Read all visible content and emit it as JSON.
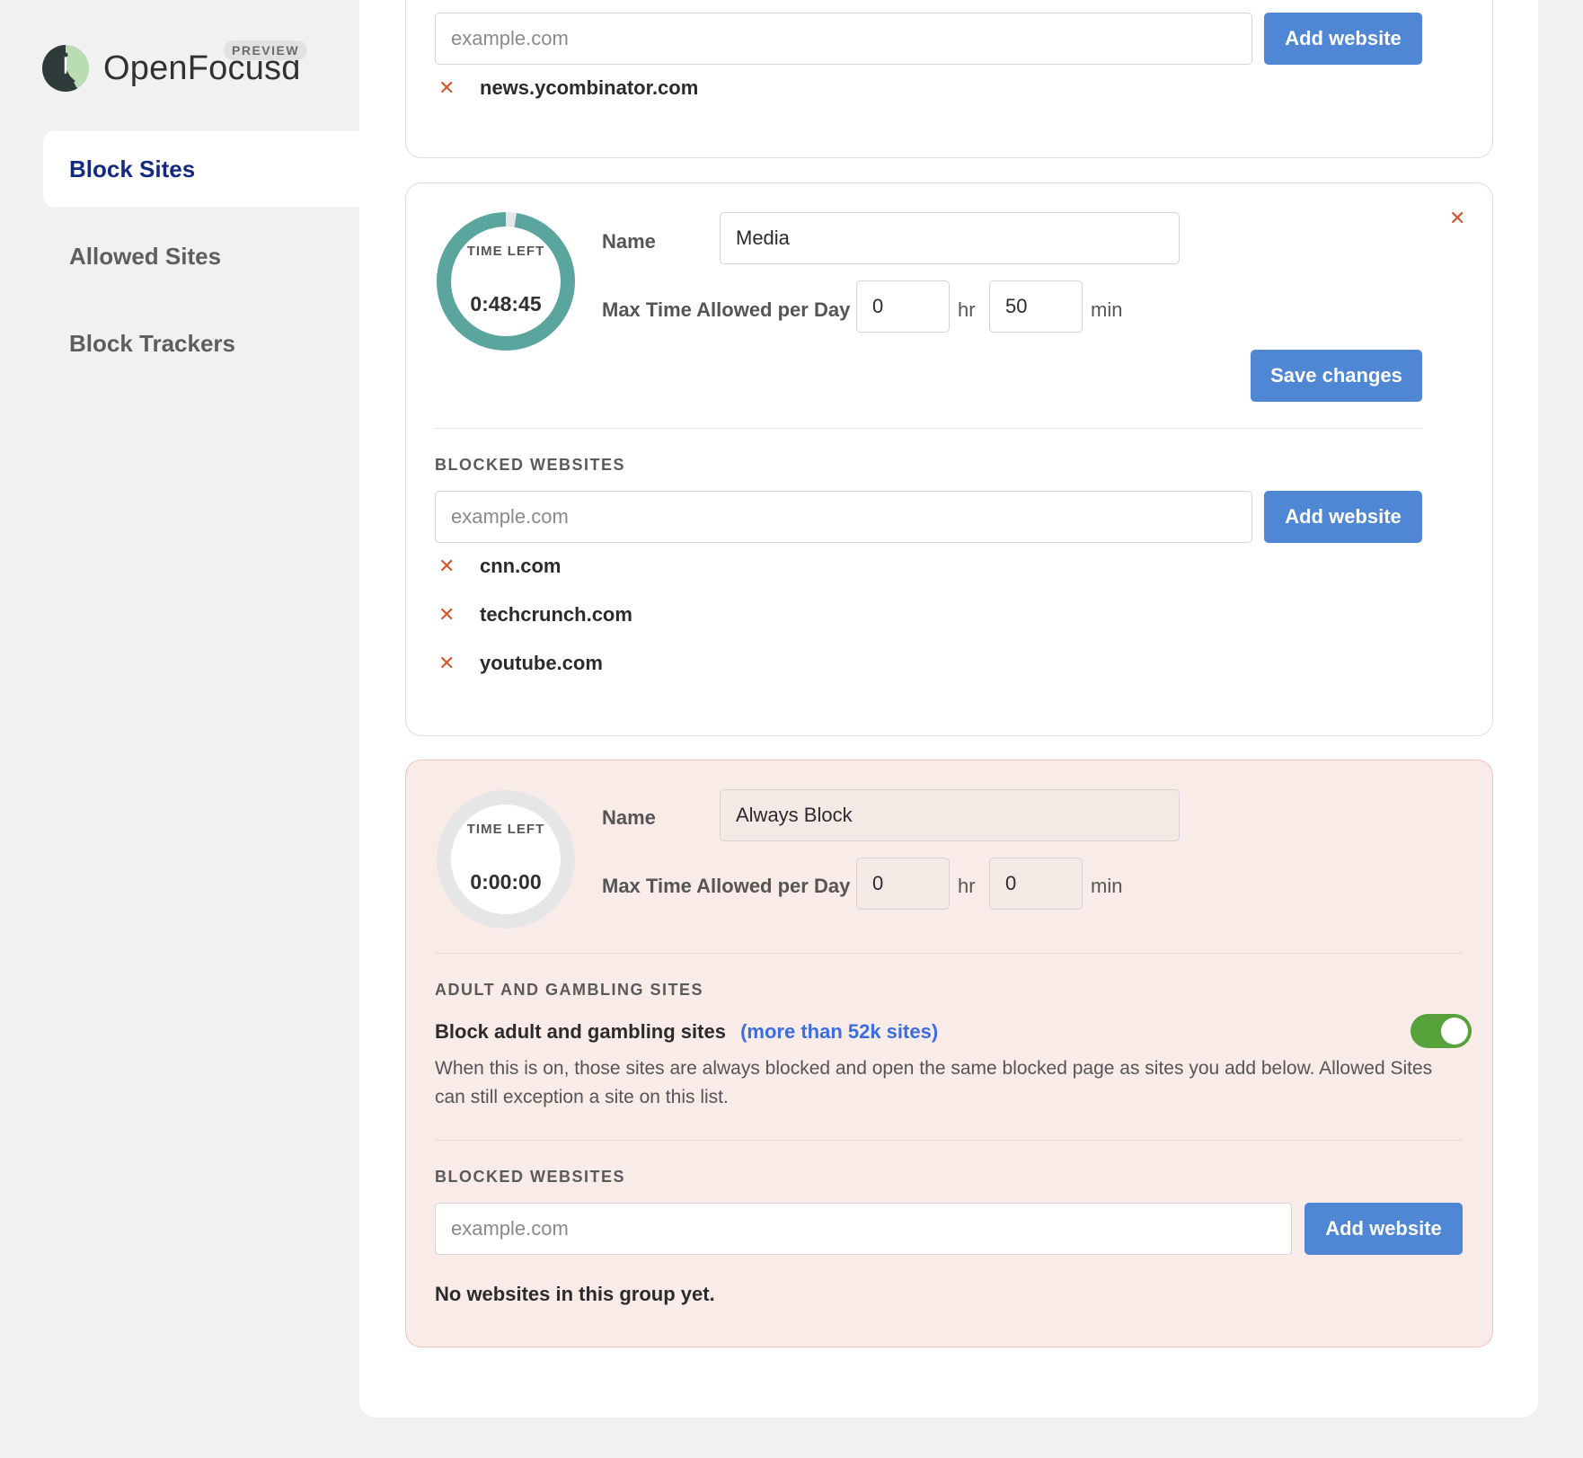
{
  "brand": {
    "name": "OpenFocusd",
    "badge": "PREVIEW"
  },
  "sidebar": {
    "items": [
      {
        "label": "Block Sites",
        "active": true
      },
      {
        "label": "Allowed Sites",
        "active": false
      },
      {
        "label": "Block Trackers",
        "active": false
      }
    ]
  },
  "groups": [
    {
      "add_placeholder": "example.com",
      "add_label": "Add website",
      "sites": [
        "news.ycombinator.com"
      ]
    },
    {
      "timer_label": "TIME LEFT",
      "timer_value": "0:48:45",
      "timer_fraction_remaining": 0.975,
      "name_label": "Name",
      "name_value": "Media",
      "max_time_label": "Max Time Allowed per Day",
      "hours": "0",
      "hr_unit": "hr",
      "minutes": "50",
      "min_unit": "min",
      "save_label": "Save changes",
      "blocked_title": "BLOCKED WEBSITES",
      "add_placeholder": "example.com",
      "add_label": "Add website",
      "sites": [
        "cnn.com",
        "techcrunch.com",
        "youtube.com"
      ]
    },
    {
      "timer_label": "TIME LEFT",
      "timer_value": "0:00:00",
      "timer_fraction_remaining": 0,
      "name_label": "Name",
      "name_value": "Always Block",
      "max_time_label": "Max Time Allowed per Day",
      "hours": "0",
      "hr_unit": "hr",
      "minutes": "0",
      "min_unit": "min",
      "adult_title": "ADULT AND GAMBLING SITES",
      "adult_toggle_label": "Block adult and gambling sites",
      "adult_link": "(more than 52k sites)",
      "adult_enabled": true,
      "adult_description": "When this is on, those sites are always blocked and open the same blocked page as sites you add below. Allowed Sites can still exception a site on this list.",
      "blocked_title": "BLOCKED WEBSITES",
      "add_placeholder": "example.com",
      "add_label": "Add website",
      "empty_text": "No websites in this group yet."
    }
  ],
  "colors": {
    "accent": "#4f87d4",
    "nav_active": "#142a80",
    "timer_ring": "#5aa59e",
    "remove": "#d4582e",
    "toggle_on": "#57a23b",
    "link": "#3a6ee0",
    "pink_card": "#f9ebe7"
  }
}
